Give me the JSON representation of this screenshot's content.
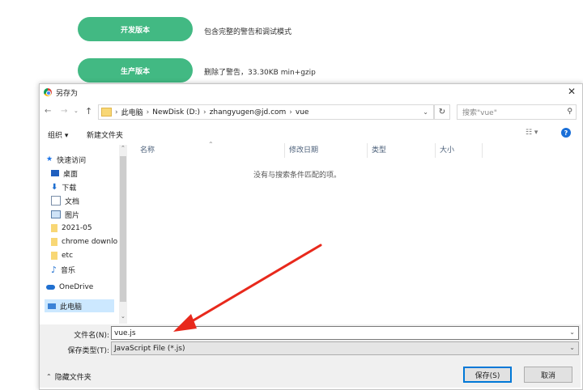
{
  "page": {
    "dev_button": "开发版本",
    "dev_desc": "包含完整的警告和调试模式",
    "prod_button": "生产版本",
    "prod_desc": "删除了警告，33.30KB min+gzip"
  },
  "dialog": {
    "title": "另存为",
    "breadcrumb": [
      "此电脑",
      "NewDisk (D:)",
      "zhangyugen@jd.com",
      "vue"
    ],
    "search_placeholder": "搜索\"vue\"",
    "toolbar": {
      "organize": "组织 ▾",
      "new_folder": "新建文件夹"
    },
    "nav_items": [
      {
        "label": "快速访问",
        "icon": "star-icon"
      },
      {
        "label": "桌面",
        "icon": "desktop-icon",
        "pinned": true
      },
      {
        "label": "下载",
        "icon": "download-icon",
        "pinned": true
      },
      {
        "label": "文档",
        "icon": "document-icon",
        "pinned": true
      },
      {
        "label": "图片",
        "icon": "picture-icon",
        "pinned": true
      },
      {
        "label": "2021-05",
        "icon": "folder-icon"
      },
      {
        "label": "chrome downlo",
        "icon": "folder-icon"
      },
      {
        "label": "etc",
        "icon": "folder-icon"
      },
      {
        "label": "音乐",
        "icon": "music-icon"
      },
      {
        "label": "OneDrive",
        "icon": "cloud-icon"
      },
      {
        "label": "此电脑",
        "icon": "computer-icon"
      }
    ],
    "columns": [
      "名称",
      "修改日期",
      "类型",
      "大小"
    ],
    "empty_message": "没有与搜索条件匹配的项。",
    "filename_label": "文件名(N):",
    "filename_value": "vue.js",
    "filetype_label": "保存类型(T):",
    "filetype_value": "JavaScript File (*.js)",
    "hide_folders": "隐藏文件夹",
    "save_button": "保存(S)",
    "cancel_button": "取消",
    "accent_color": "#42b983",
    "arrow_color": "#e8291c"
  }
}
